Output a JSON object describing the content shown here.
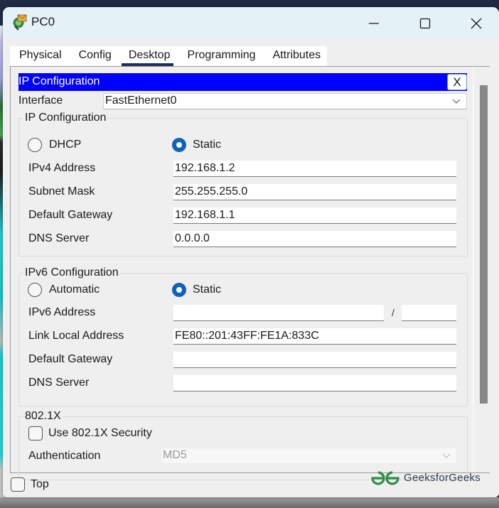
{
  "window": {
    "title": "PC0",
    "icon": "pc-envelope-icon",
    "controls": {
      "minimize": "minimize-icon",
      "maximize": "maximize-icon",
      "close": "close-icon"
    }
  },
  "tabs": [
    {
      "label": "Physical",
      "active": false
    },
    {
      "label": "Config",
      "active": false
    },
    {
      "label": "Desktop",
      "active": true
    },
    {
      "label": "Programming",
      "active": false
    },
    {
      "label": "Attributes",
      "active": false
    }
  ],
  "panel": {
    "title": "IP Configuration",
    "close_label": "X",
    "header_color": "#0000ff"
  },
  "interface": {
    "label": "Interface",
    "value": "FastEthernet0"
  },
  "ipv4": {
    "group_title": "IP Configuration",
    "mode_options": [
      {
        "label": "DHCP",
        "selected": false
      },
      {
        "label": "Static",
        "selected": true
      }
    ],
    "fields": [
      {
        "label": "IPv4 Address",
        "value": "192.168.1.2"
      },
      {
        "label": "Subnet Mask",
        "value": "255.255.255.0"
      },
      {
        "label": "Default Gateway",
        "value": "192.168.1.1"
      },
      {
        "label": "DNS Server",
        "value": "0.0.0.0"
      }
    ]
  },
  "ipv6": {
    "group_title": "IPv6 Configuration",
    "mode_options": [
      {
        "label": "Automatic",
        "selected": false
      },
      {
        "label": "Static",
        "selected": true
      }
    ],
    "address": {
      "label": "IPv6 Address",
      "value": "",
      "prefix_separator": "/",
      "prefix_value": ""
    },
    "fields": [
      {
        "label": "Link Local Address",
        "value": "FE80::201:43FF:FE1A:833C"
      },
      {
        "label": "Default Gateway",
        "value": ""
      },
      {
        "label": "DNS Server",
        "value": ""
      }
    ]
  },
  "dot1x": {
    "group_title": "802.1X",
    "use_security": {
      "label": "Use 802.1X Security",
      "checked": false
    },
    "authentication": {
      "label": "Authentication",
      "value": "MD5",
      "disabled": true
    }
  },
  "footer": {
    "top_checkbox": {
      "label": "Top",
      "checked": false
    },
    "watermark": "GeeksforGeeks",
    "watermark_color": "#2f8d46"
  },
  "colors": {
    "radio_selected": "#0f62b8",
    "active_tab_underline": "#1b2e5a",
    "scrollbar_thumb": "#888888"
  }
}
